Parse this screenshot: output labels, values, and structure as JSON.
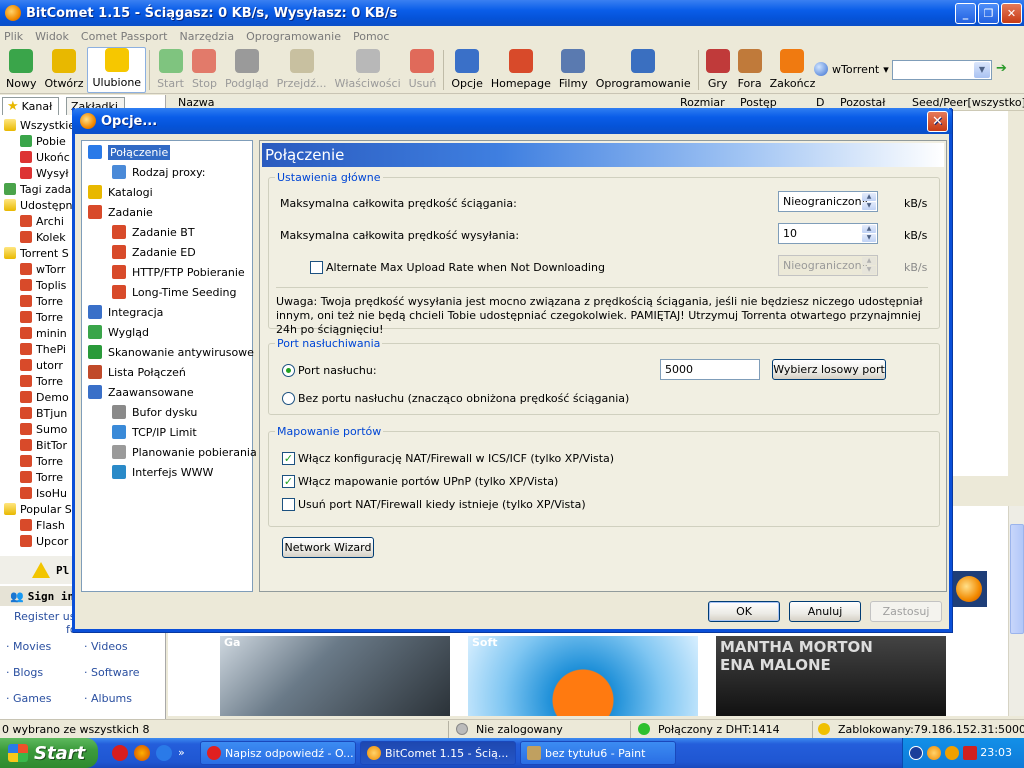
{
  "window": {
    "title": "BitComet 1.15 - Ściągasz: 0 KB/s, Wysyłasz: 0 KB/s",
    "min_label": "_",
    "max_label": "❐",
    "close_label": "✕"
  },
  "menu": [
    "Plik",
    "Widok",
    "Comet Passport",
    "Narzędzia",
    "Oprogramowanie",
    "Pomoc"
  ],
  "toolbar": {
    "buttons": [
      {
        "label": "Nowy",
        "icon": "new-icon",
        "color": "#3aa54a"
      },
      {
        "label": "Otwórz",
        "icon": "open-icon",
        "color": "#e8b800"
      },
      {
        "label": "Ulubione",
        "icon": "favorites-star-icon",
        "color": "#f6c700"
      },
      {
        "label": "Start",
        "icon": "play-icon",
        "color": "#7fc47f"
      },
      {
        "label": "Stop",
        "icon": "stop-icon",
        "color": "#e27a6a"
      },
      {
        "label": "Podgląd",
        "icon": "preview-icon",
        "color": "#9a9a9a"
      },
      {
        "label": "Przejdź...",
        "icon": "goto-folder-icon",
        "color": "#c8c0a0"
      },
      {
        "label": "Właściwości",
        "icon": "properties-icon",
        "color": "#b8b8b8"
      },
      {
        "label": "Usuń",
        "icon": "delete-icon",
        "color": "#e06a5a"
      },
      {
        "label": "Opcje",
        "icon": "options-icon",
        "color": "#3a70c8"
      },
      {
        "label": "Homepage",
        "icon": "home-icon",
        "color": "#d84a2a"
      },
      {
        "label": "Filmy",
        "icon": "film-icon",
        "color": "#5a7ab0"
      },
      {
        "label": "Oprogramowanie",
        "icon": "software-icon",
        "color": "#3a6fc0"
      },
      {
        "label": "Gry",
        "icon": "games-icon",
        "color": "#c03a3a"
      },
      {
        "label": "Fora",
        "icon": "forum-icon",
        "color": "#c07a3a"
      },
      {
        "label": "Zakończ",
        "icon": "power-icon",
        "color": "#f07a10"
      }
    ],
    "wtorrent_label": "wTorrent",
    "search_value": ""
  },
  "sidebar": {
    "tab1": "Kanał",
    "tab2": "Zakładki",
    "items": [
      {
        "label": "Wszystkie",
        "icon": "folder",
        "indent": 0
      },
      {
        "label": "Pobie",
        "icon": "green",
        "indent": 1
      },
      {
        "label": "Ukońc",
        "icon": "red",
        "indent": 1
      },
      {
        "label": "Wysył",
        "icon": "red",
        "indent": 1
      },
      {
        "label": "Tagi zada",
        "icon": "tag",
        "indent": 0
      },
      {
        "label": "Udostępn",
        "icon": "folder",
        "indent": 0
      },
      {
        "label": "Archi",
        "icon": "doc",
        "indent": 1
      },
      {
        "label": "Kolek",
        "icon": "doc",
        "indent": 1
      },
      {
        "label": "Torrent S",
        "icon": "folder",
        "indent": 0
      },
      {
        "label": "wTorr",
        "icon": "doc",
        "indent": 1
      },
      {
        "label": "Toplis",
        "icon": "doc",
        "indent": 1
      },
      {
        "label": "Torre",
        "icon": "doc",
        "indent": 1
      },
      {
        "label": "Torre",
        "icon": "doc",
        "indent": 1
      },
      {
        "label": "minin",
        "icon": "doc",
        "indent": 1
      },
      {
        "label": "ThePi",
        "icon": "doc",
        "indent": 1
      },
      {
        "label": "utorr",
        "icon": "doc",
        "indent": 1
      },
      {
        "label": "Torre",
        "icon": "doc",
        "indent": 1
      },
      {
        "label": "Demo",
        "icon": "doc",
        "indent": 1
      },
      {
        "label": "BTjun",
        "icon": "doc",
        "indent": 1
      },
      {
        "label": "Sumo",
        "icon": "doc",
        "indent": 1
      },
      {
        "label": "BitTor",
        "icon": "doc",
        "indent": 1
      },
      {
        "label": "Torre",
        "icon": "doc",
        "indent": 1
      },
      {
        "label": "Torre",
        "icon": "doc",
        "indent": 1
      },
      {
        "label": "IsoHu",
        "icon": "doc",
        "indent": 1
      },
      {
        "label": "Popular S",
        "icon": "folder",
        "indent": 0
      },
      {
        "label": "Flash",
        "icon": "doc",
        "indent": 1
      },
      {
        "label": "Upcor",
        "icon": "doc",
        "indent": 1
      }
    ]
  },
  "promo": {
    "warning": "Pl",
    "sign_in": "Sign in",
    "register": "Register us",
    "register_line2": "fo",
    "links": [
      "Movies",
      "Videos",
      "Blogs",
      "Software",
      "Games",
      "Albums"
    ]
  },
  "list_header": {
    "name": "Nazwa",
    "size": "Rozmiar",
    "progress": "Postęp",
    "d": "D",
    "remaining": "Pozostał",
    "seed_peer": "Seed/Peer[wszystko]"
  },
  "ads": {
    "tile1_caption": "Ga",
    "tile2_caption": "Soft",
    "tile3_text1": "MANTHA MORTON",
    "tile3_text2": "ENA MALONE"
  },
  "dialog": {
    "title": "Opcje...",
    "close_label": "✕",
    "nav": [
      {
        "label": "Połączenie",
        "icon": "globe-icon",
        "color": "#2a7ae8",
        "level": 0,
        "selected": true
      },
      {
        "label": "Rodzaj proxy:",
        "icon": "proxy-icon",
        "color": "#4a8ad8",
        "level": 1
      },
      {
        "label": "Katalogi",
        "icon": "folder-icon",
        "color": "#e8b800",
        "level": 0
      },
      {
        "label": "Zadanie",
        "icon": "task-icon",
        "color": "#d84a2a",
        "level": 0
      },
      {
        "label": "Zadanie BT",
        "icon": "task-bt-icon",
        "color": "#d84a2a",
        "level": 1
      },
      {
        "label": "Zadanie ED",
        "icon": "task-ed-icon",
        "color": "#d84a2a",
        "level": 1
      },
      {
        "label": "HTTP/FTP Pobieranie",
        "icon": "http-ftp-icon",
        "color": "#d84a2a",
        "level": 1
      },
      {
        "label": "Long-Time Seeding",
        "icon": "seeding-icon",
        "color": "#d84a2a",
        "level": 1
      },
      {
        "label": "Integracja",
        "icon": "integration-icon",
        "color": "#3a70c8",
        "level": 0
      },
      {
        "label": "Wygląd",
        "icon": "appearance-icon",
        "color": "#3aa54a",
        "level": 0
      },
      {
        "label": "Skanowanie antywirusowe",
        "icon": "shield-icon",
        "color": "#2a9a3a",
        "level": 0
      },
      {
        "label": "Lista Połączeń",
        "icon": "peers-icon",
        "color": "#c04a2a",
        "level": 0
      },
      {
        "label": "Zaawansowane",
        "icon": "advanced-icon",
        "color": "#3a70c8",
        "level": 0
      },
      {
        "label": "Bufor dysku",
        "icon": "disk-icon",
        "color": "#8a8a8a",
        "level": 1
      },
      {
        "label": "TCP/IP Limit",
        "icon": "network-icon",
        "color": "#3a8ad8",
        "level": 1
      },
      {
        "label": "Planowanie pobierania",
        "icon": "schedule-icon",
        "color": "#9a9a9a",
        "level": 1
      },
      {
        "label": "Interfejs WWW",
        "icon": "www-icon",
        "color": "#2a8ac8",
        "level": 1
      }
    ],
    "header": "Połączenie",
    "main_settings": {
      "legend": "Ustawienia główne",
      "download_label": "Maksymalna całkowita prędkość ściągania:",
      "download_value": "Nieograniczony",
      "upload_label": "Maksymalna całkowita prędkość wysyłania:",
      "upload_value": "10",
      "unit": "kB/s",
      "alt_upload_label": "Alternate Max Upload Rate when Not Downloading",
      "alt_upload_checked": false,
      "alt_upload_value": "Nieograniczony",
      "note": "Uwaga: Twoja prędkość wysyłania jest mocno związana z prędkością ściągania, jeśli nie będziesz niczego udostępniał innym, oni też nie będą chcieli Tobie udostępniać czegokolwiek. PAMIĘTAJ! Utrzymuj Torrenta otwartego przynajmniej 24h po ściągnięciu!"
    },
    "listen_port": {
      "legend": "Port nasłuchiwania",
      "port_radio_label": "Port nasłuchu:",
      "port_value": "5000",
      "random_button": "Wybierz losowy port",
      "no_port_label": "Bez portu nasłuchu (znacząco obniżona prędkość ściągania)",
      "selected": "port"
    },
    "port_mapping": {
      "legend": "Mapowanie portów",
      "nat_icsf_label": "Włącz konfigurację NAT/Firewall w ICS/ICF (tylko XP/Vista)",
      "nat_icsf_checked": true,
      "upnp_label": "Włącz mapowanie portów UPnP (tylko XP/Vista)",
      "upnp_checked": true,
      "remove_label": "Usuń port NAT/Firewall kiedy istnieje (tylko XP/Vista)",
      "remove_checked": false
    },
    "network_wizard": "Network Wizard",
    "ok": "OK",
    "cancel": "Anuluj",
    "apply": "Zastosuj"
  },
  "status": {
    "selected": "0 wybrano ze wszystkich 8",
    "login": "Nie zalogowany",
    "dht": "Połączony z DHT:1414",
    "blocked": "Zablokowany:79.186.152.31:5000"
  },
  "taskbar": {
    "start": "Start",
    "tasks": [
      {
        "label": "Napisz odpowiedź - O...",
        "active": false,
        "color": "#e02020"
      },
      {
        "label": "BitComet 1.15 - Ścią...",
        "active": true,
        "color": "#f28a00"
      },
      {
        "label": "bez tytułu6 - Paint",
        "active": false,
        "color": "#c0a060"
      }
    ],
    "clock": "23:03"
  }
}
